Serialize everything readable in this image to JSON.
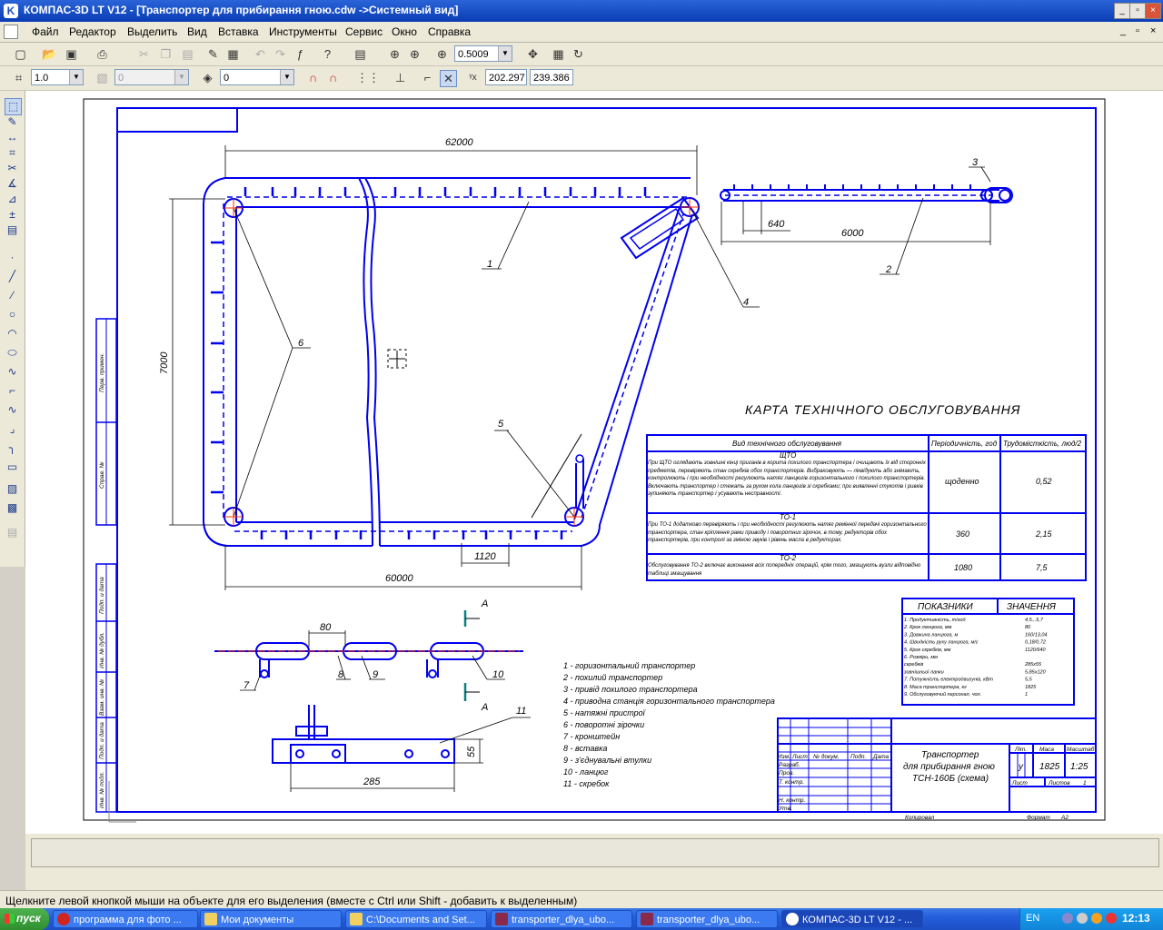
{
  "window": {
    "title": "КОМПАС-3D LT V12 - [Транспортер для прибирання гною.cdw ->Системный вид]",
    "icon_name": "kompas-logo-icon"
  },
  "menu": [
    "Файл",
    "Редактор",
    "Выделить",
    "Вид",
    "Вставка",
    "Инструменты",
    "Сервис",
    "Окно",
    "Справка"
  ],
  "toolbar": {
    "zoom": "0.5009",
    "step": "1.0",
    "style": "0",
    "layer": "0",
    "coord_x": "202.297",
    "coord_y": "239.386"
  },
  "drawing": {
    "dim_62000": "62000",
    "dim_7000": "7000",
    "dim_60000": "60000",
    "dim_1120": "1120",
    "dim_640": "640",
    "dim_6000": "6000",
    "dim_80": "80",
    "dim_55": "55",
    "dim_285": "285",
    "view_a": "А",
    "callouts": [
      "1",
      "2",
      "3",
      "4",
      "5",
      "6",
      "7",
      "8",
      "9",
      "10",
      "11"
    ],
    "map_title": "КАРТА ТЕХНІЧНОГО ОБСЛУГОВУВАННЯ",
    "map_headers": [
      "Вид технічного обслуговування",
      "Періодичність, год",
      "Трудомісткість, люд/2"
    ],
    "map_rows": [
      {
        "code": "ЩТО",
        "text": "При ЩТО оглядають зовнішні кінці приганів в корита похилого транспортера і очищають їх від сторонніх предметів, перевіряють стан скребків обох транспортерів. Вибраковують — ліквідують або знімають, контролюють і при необхідності регулюють натяг ланцюгів горизонтального і похилого транспортерів. Включають транспортер і стежать за рухом кола ланцюгів зі скребками; при виявленні стукотів і ривків зупиняють транспортер і усувають несправності.",
        "period": "щоденно",
        "labor": "0,52"
      },
      {
        "code": "ТО-1",
        "text": "При ТО-1 додатково перевіряють і при необхідності регулюють натяг ремінної передачі горизонтального транспортера, стан кріплення рами приводу і поворотних зірочок, в тому, редукторів обох транспортерів, при контролі за зміною звуків і рівень масла в редукторах.",
        "period": "360",
        "labor": "2,15"
      },
      {
        "code": "ТО-2",
        "text": "Обслуговування ТО-2 включає виконання всіх попередніх операцій, крім того, змащують вузли відповідно таблиці змащування",
        "period": "1080",
        "labor": "7,5"
      }
    ],
    "indicators_headers": [
      "ПОКАЗНИКИ",
      "ЗНАЧЕННЯ"
    ],
    "indicators": [
      [
        "1. Продуктивність, т/год",
        "4,5...5,7"
      ],
      [
        "2. Крок ланцюга, мм",
        "80"
      ],
      [
        "3. Довжина ланцюга, м",
        "160/13,04"
      ],
      [
        "4. Швидкість руху ланцюга, м/с",
        "0,18/0,72"
      ],
      [
        "5. Крок скребків, мм",
        "1120/640"
      ],
      [
        "6. Розміри, мм",
        ""
      ],
      [
        "скребків",
        "285х55"
      ],
      [
        "зовнішньої ланки",
        "5,85х120"
      ],
      [
        "7. Потужність електродвигунів, кВт",
        "5,5"
      ],
      [
        "8. Маса транспортера, кг",
        "1825"
      ],
      [
        "9. Обслуговуючий персонал, чол.",
        "1"
      ]
    ],
    "legend": [
      "1 - горизонтальний транспортер",
      "2 - похилий транспортер",
      "3 - привід похилого транспортера",
      "4 - приводна станція горизонтального транспортера",
      "5 - натяжні пристрої",
      "6 - поворотні зірочки",
      "7 - кронштейн",
      "8 - вставка",
      "9 - з'єднувальні втулки",
      "10 - ланцюг",
      "11 - скребок"
    ],
    "stamp": {
      "name_1": "Транспортер",
      "name_2": "для прибирання гною",
      "name_3": "ТСН-160Б (схема)",
      "lit_h": "Літ.",
      "mass_h": "Маса",
      "scale_h": "Масштаб",
      "lit": "у",
      "mass": "1825",
      "scale": "1:25",
      "sheet": "Лист",
      "sheets": "Листов",
      "sheets_n": "1",
      "rows_left": [
        "Изм.",
        "Лист",
        "№ докум.",
        "Подп.",
        "Дата"
      ],
      "roles": [
        "Разраб.",
        "Пров.",
        "Т. контр.",
        "",
        "Н. контр.",
        "Утв."
      ],
      "copy": "Копировал",
      "format": "Формат",
      "format_v": "А2"
    },
    "side_labels": [
      "Перв. примен.",
      "Справ. №",
      "Подп. и дата",
      "Инв. № дубл.",
      "Взам. инв. №",
      "Подп. и дата",
      "Инв. № подл."
    ]
  },
  "status": "Щелкните левой кнопкой мыши на объекте для его выделения (вместе с Ctrl или Shift - добавить к выделенным)",
  "taskbar": {
    "start": "пуск",
    "items": [
      "программа для фото ...",
      "Мои документы",
      "C:\\Documents and Set...",
      "transporter_dlya_ubo...",
      "transporter_dlya_ubo...",
      "КОМПАС-3D LT V12 - ..."
    ],
    "lang": "EN",
    "clock": "12:13"
  },
  "colors": {
    "drawing": "#0000ee",
    "axis": "#ff3300",
    "title_bar": "#0a3cb4",
    "accent": "#0a8080"
  }
}
